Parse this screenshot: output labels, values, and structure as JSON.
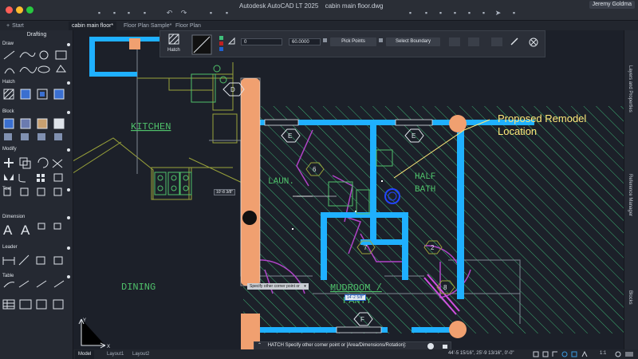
{
  "app": {
    "title": "Autodesk AutoCAD LT 2025",
    "file_name": "cabin main floor.dwg",
    "user": "Jeremy Goldma"
  },
  "tabs": [
    "Start",
    "cabin main floor*",
    "Floor Plan Sample*",
    "Floor Plan"
  ],
  "palette": {
    "title": "Drafting",
    "sections": [
      "Draw",
      "Hatch",
      "Block",
      "Modify",
      "Text",
      "Dimension",
      "Leader",
      "Table"
    ]
  },
  "hatch_toolbar": {
    "label": "Hatch",
    "transparency": "0",
    "angle": "60.0000",
    "pick_points": "Pick Points",
    "select_boundary": "Select Boundary"
  },
  "drawing": {
    "kitchen": "KITCHEN",
    "dining": "DINING",
    "laundry": "LAUN.",
    "half_bath_1": "HALF",
    "half_bath_2": "BATH",
    "mudroom_1": "MUDROOM /",
    "mudroom_2": "PANTY",
    "annotation_1": "Proposed Remodel",
    "annotation_2": "Location",
    "tag_d": "D",
    "tag_e1": "E",
    "tag_e2": "E",
    "tag_f": "F",
    "tag_6": "6",
    "tag_7": "7",
    "tag_2": "2",
    "tag_8": "8"
  },
  "tooltips": {
    "dimension": "10'-8 3/8\"",
    "prompt": "Specify other corner point or",
    "dynamic_input": "14'-2 5/8\""
  },
  "command_line": "HATCH Specify other corner point or [Area/Dimensions/Rotation]:",
  "layout_tabs": [
    "Model",
    "Layout1",
    "Layout2"
  ],
  "status": {
    "coordinates": "44'-5 15/16\", 25'-9 13/16\", 0'-0\"",
    "scale": "1:1"
  },
  "side_panels": [
    "Layers and Properties",
    "Reference Manager",
    "Blocks"
  ],
  "colors": {
    "walls": "#1fb0ff",
    "hatch": "#3fbf7a",
    "accent": "#f0a070",
    "annotation": "#ffe97a"
  }
}
